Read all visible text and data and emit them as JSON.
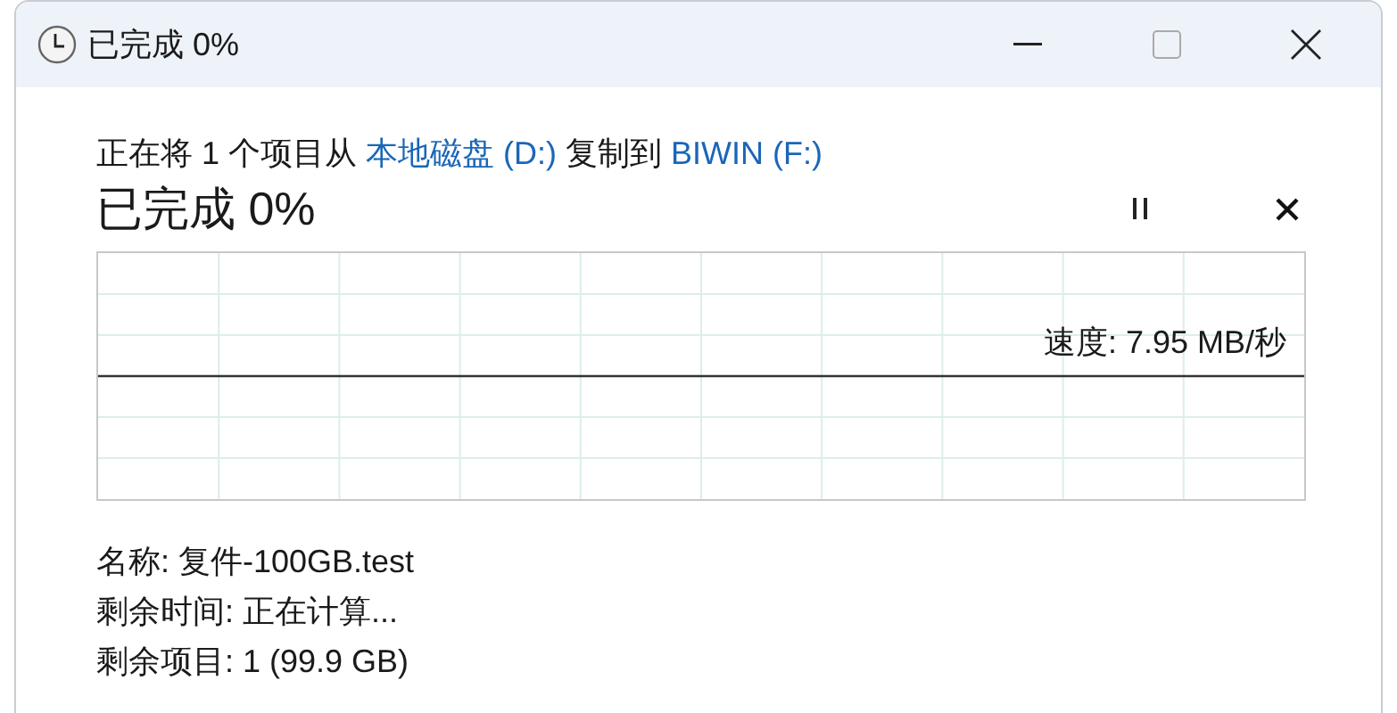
{
  "window": {
    "title": "已完成 0%"
  },
  "description": [
    {
      "kind": "text",
      "text": "正在将 1 个项目从 "
    },
    {
      "kind": "link",
      "text": "本地磁盘 (D:)"
    },
    {
      "kind": "text",
      "text": " 复制到 "
    },
    {
      "kind": "link",
      "text": "BIWIN (F:)"
    }
  ],
  "progress_heading": "已完成 0%",
  "speed": "速度: 7.95 MB/秒",
  "details": [
    "名称: 复件-100GB.test",
    "剩余时间: 正在计算...",
    "剩余项目: 1 (99.9 GB)"
  ]
}
